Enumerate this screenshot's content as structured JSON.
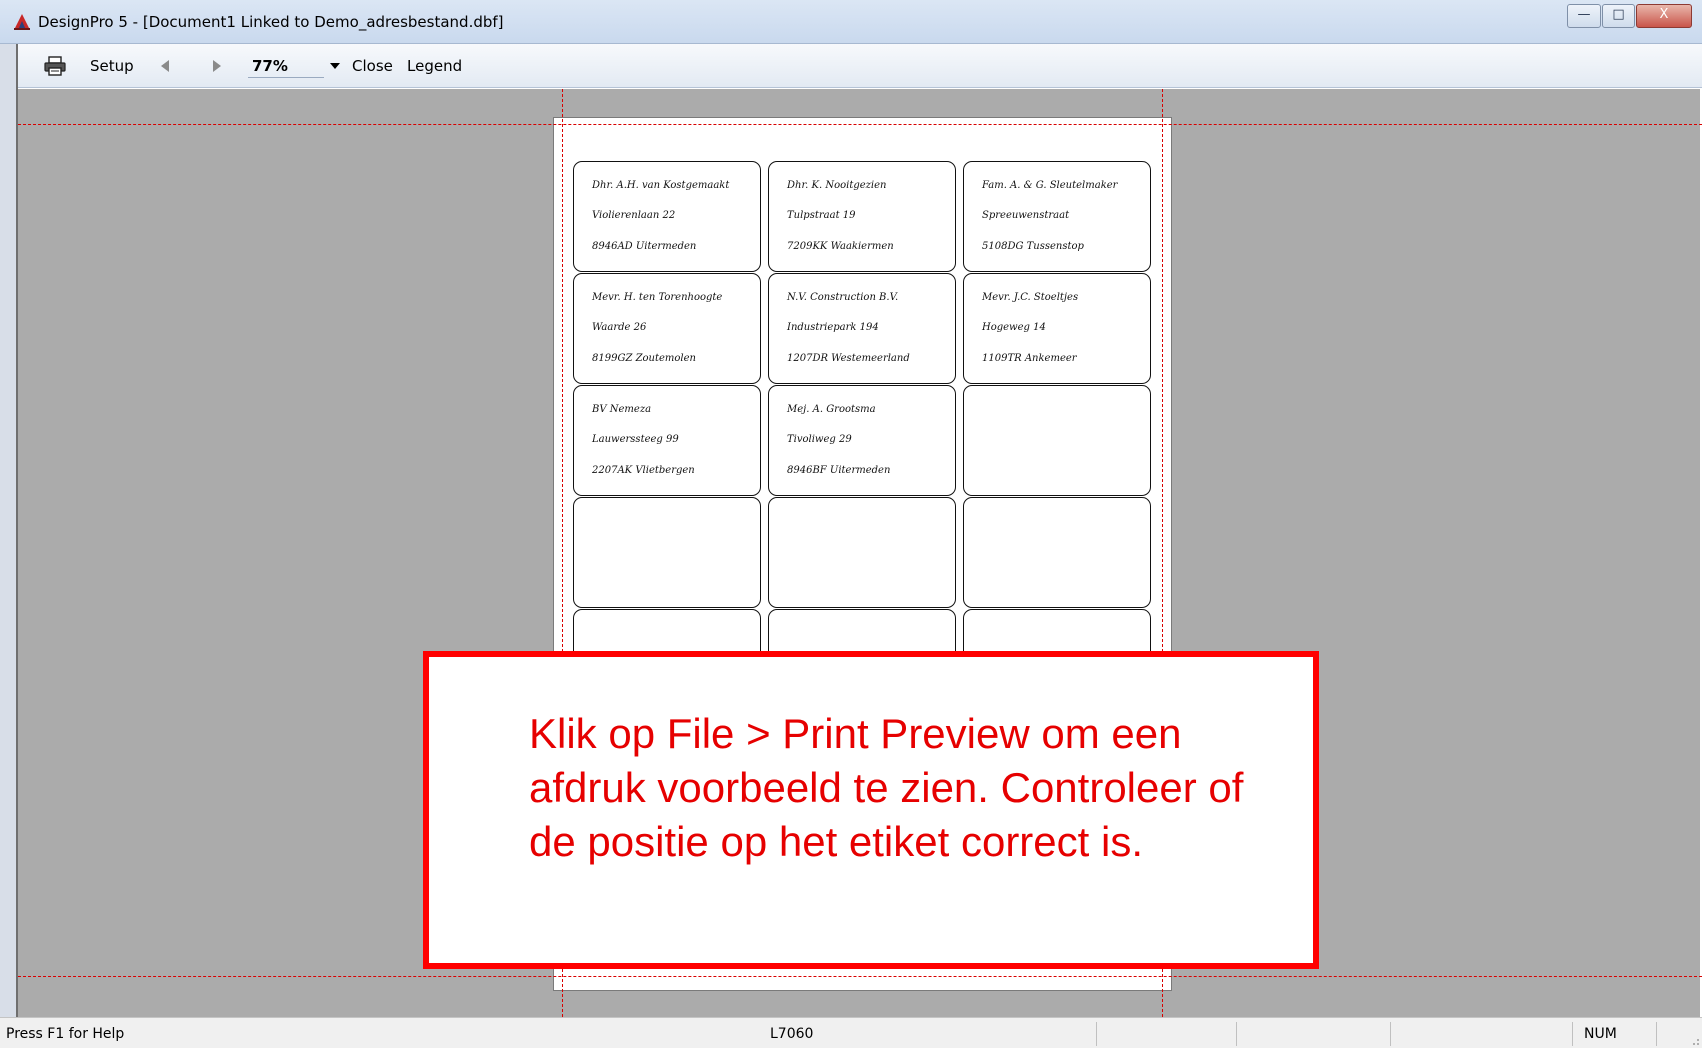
{
  "window": {
    "title": "DesignPro 5 - [Document1 Linked to Demo_adresbestand.dbf]",
    "minimize_glyph": "—",
    "maximize_glyph": "□",
    "close_glyph": "X"
  },
  "toolbar": {
    "print_icon": "printer-icon",
    "setup_label": "Setup",
    "prev_icon": "arrow-left-icon",
    "next_icon": "arrow-right-icon",
    "zoom_value": "77%",
    "close_label": "Close",
    "legend_label": "Legend"
  },
  "labels": [
    {
      "lines": [
        "Dhr. A.H. van Kostgemaakt",
        "Violierenlaan 22",
        "8946AD Uitermeden"
      ]
    },
    {
      "lines": [
        "Dhr. K. Nooitgezien",
        "Tulpstraat 19",
        "7209KK Waakiermen"
      ]
    },
    {
      "lines": [
        "Fam. A. & G. Sleutelmaker",
        "Spreeuwenstraat",
        "5108DG Tussenstop"
      ]
    },
    {
      "lines": [
        "Mevr. H. ten Torenhoogte",
        "Waarde 26",
        "8199GZ Zoutemolen"
      ]
    },
    {
      "lines": [
        "N.V. Construction B.V.",
        "Industriepark 194",
        "1207DR Westemeerland"
      ]
    },
    {
      "lines": [
        "Mevr. J.C. Stoeltjes",
        "Hogeweg 14",
        "1109TR Ankemeer"
      ]
    },
    {
      "lines": [
        "BV Nemeza",
        "Lauwerssteeg 99",
        "2207AK Vlietbergen"
      ]
    },
    {
      "lines": [
        "Mej. A. Grootsma",
        "Tivoliweg 29",
        "8946BF Uitermeden"
      ]
    },
    {
      "lines": [
        "",
        "",
        ""
      ]
    },
    {
      "lines": [
        "",
        "",
        ""
      ]
    },
    {
      "lines": [
        "",
        "",
        ""
      ]
    },
    {
      "lines": [
        "",
        "",
        ""
      ]
    },
    {
      "lines": [
        "",
        "",
        ""
      ]
    },
    {
      "lines": [
        "",
        "",
        ""
      ]
    },
    {
      "lines": [
        "",
        "",
        ""
      ]
    }
  ],
  "callout": {
    "text": "Klik op File > Print Preview om een afdruk voorbeeld te zien. Controleer of de positie op het etiket correct is."
  },
  "statusbar": {
    "help_text": "Press F1 for Help",
    "template": "L7060",
    "num": "NUM"
  },
  "colors": {
    "workspace": "#ababab",
    "callout_border": "#ff0000",
    "callout_text": "#e60000",
    "margin_guides": "#d90000"
  }
}
